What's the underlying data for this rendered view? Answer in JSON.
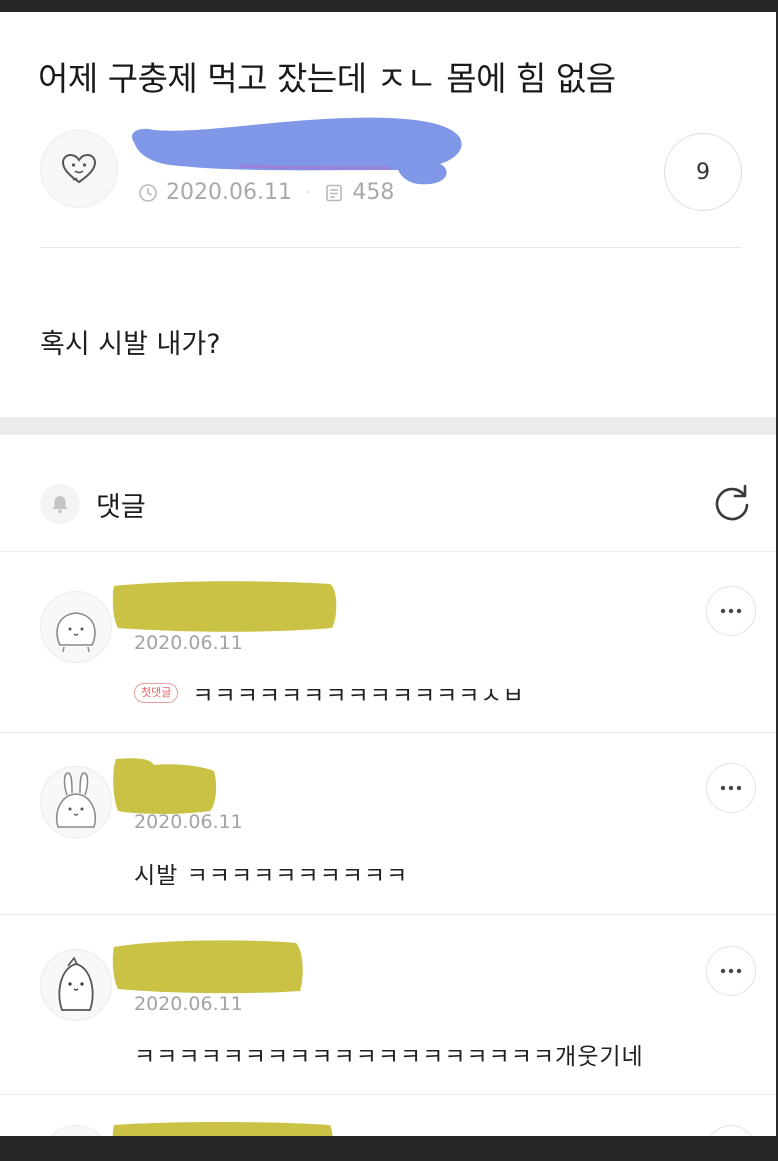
{
  "post": {
    "title": "어제 구충제 먹고 잤는데 ㅈㄴ 몸에 힘 없음",
    "date": "2020.06.11",
    "views": "458",
    "comment_count": "9",
    "body": "혹시 시발 내가?"
  },
  "comments_section": {
    "label": "댓글"
  },
  "comments": [
    {
      "date": "2020.06.11",
      "badge": "첫댓글",
      "text": "ㅋㅋㅋㅋㅋㅋㅋㅋㅋㅋㅋㅋㅋㅅㅂ"
    },
    {
      "date": "2020.06.11",
      "text": "시발 ㅋㅋㅋㅋㅋㅋㅋㅋㅋㅋ"
    },
    {
      "date": "2020.06.11",
      "text": "ㅋㅋㅋㅋㅋㅋㅋㅋㅋㅋㅋㅋㅋㅋㅋㅋㅋㅋㅋ개웃기네"
    }
  ],
  "colors": {
    "nickname_redaction_post": "#7f97e6",
    "nickname_redaction_comments": "#c9c245",
    "first_badge": "#e06666"
  }
}
